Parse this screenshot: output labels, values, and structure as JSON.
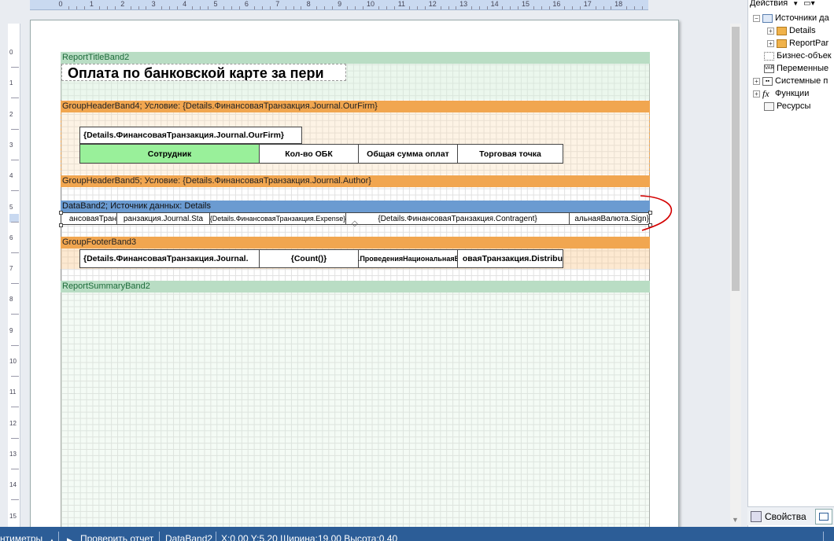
{
  "ruler": {
    "h_marks": [
      "0",
      "1",
      "2",
      "3",
      "4",
      "5",
      "6",
      "7",
      "8",
      "9",
      "10",
      "11",
      "12",
      "13",
      "14",
      "15",
      "16",
      "17",
      "18"
    ],
    "v_marks": [
      "0",
      "1",
      "2",
      "3",
      "4",
      "5",
      "6",
      "7",
      "8",
      "9",
      "10",
      "11",
      "12",
      "13",
      "14",
      "15"
    ]
  },
  "bands": {
    "title": "ReportTitleBand2",
    "gh4": "GroupHeaderBand4; Условие: {Details.ФинансоваяТранзакция.Journal.OurFirm}",
    "gh5": "GroupHeaderBand5; Условие: {Details.ФинансоваяТранзакция.Journal.Author}",
    "data": "DataBand2; Источник данных: Details",
    "gf3": "GroupFooterBand3",
    "summary": "ReportSummaryBand2"
  },
  "report": {
    "title_text": "Оплата по банковской карте за пери",
    "ourfirm_field": "{Details.ФинансоваяТранзакция.Journal.OurFirm}",
    "headers": [
      "Сотрудник",
      "Кол-во ОБК",
      "Общая сумма оплат",
      "Торговая точка"
    ],
    "data_cells": [
      "ансоваяТран",
      "ранзакция.Journal.Sta",
      "{Details.ФинансоваяТранзакция.Expense}",
      "{Details.ФинансоваяТранзакция.Contragent}",
      "альнаяВалюта.Sign}"
    ],
    "footer_cells": [
      "{Details.ФинансоваяТранзакция.Journal.",
      "{Count()}",
      "Details.ПроведенияНациональнаяВалюта",
      "оваяТранзакция.Distribu"
    ]
  },
  "tree": {
    "toolbar": {
      "actions_label": "Действия"
    },
    "items": [
      "Источники да",
      "Details",
      "ReportPar",
      "Бизнес-объек",
      "Переменные",
      "Системные п",
      "Функции",
      "Ресурсы"
    ]
  },
  "tabs": {
    "properties": "Свойства"
  },
  "statusbar": {
    "units": "нтиметры",
    "check": "Проверить отчет",
    "component": "DataBand2",
    "position": "X:0,00  Y:5,20  Ширина:19,00  Высота:0,40"
  },
  "colors": {
    "title_band": "#b9ddc4",
    "group_band": "#f1a650",
    "data_band": "#6b9bd1",
    "header_green": "#99f09a",
    "selection_marker": "#d40000",
    "statusbar": "#2c5d97"
  }
}
